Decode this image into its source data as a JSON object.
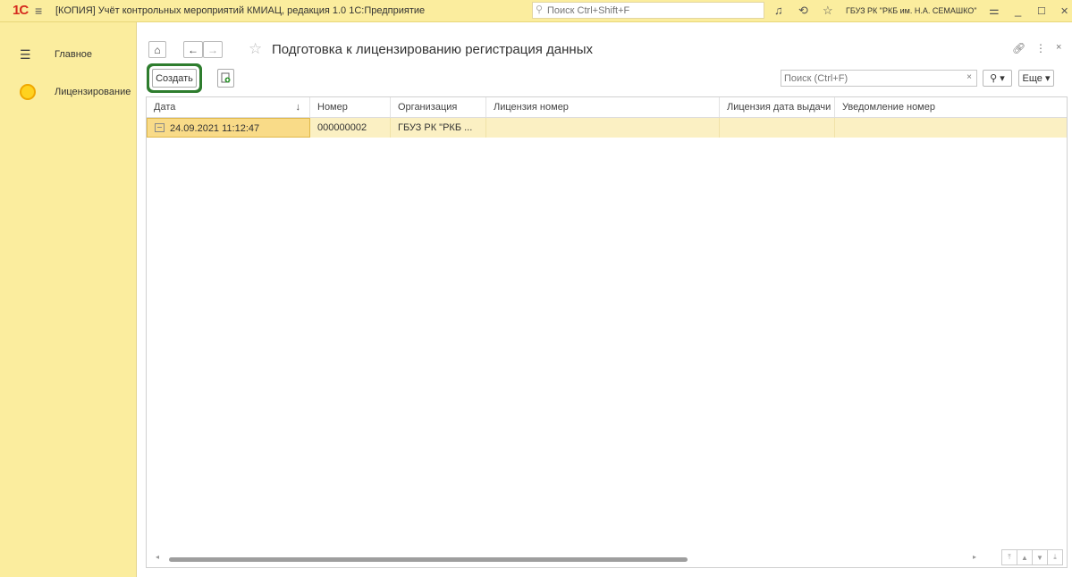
{
  "titlebar": {
    "logo": "1C",
    "title": "[КОПИЯ] Учёт контрольных мероприятий КМИАЦ, редакция 1.0 1С:Предприятие",
    "search_placeholder": "Поиск Ctrl+Shift+F",
    "user": "ГБУЗ РК \"РКБ им. Н.А. СЕМАШКО\""
  },
  "sidebar": {
    "items": [
      {
        "label": "Главное",
        "icon": "hamburger-icon"
      },
      {
        "label": "Лицензирование",
        "icon": "sun-icon"
      }
    ]
  },
  "page": {
    "title": "Подготовка к лицензированию регистрация данных"
  },
  "toolbar": {
    "create_label": "Создать",
    "search_placeholder": "Поиск (Ctrl+F)",
    "more_label": "Еще ▾"
  },
  "table": {
    "columns": [
      "Дата",
      "Номер",
      "Организация",
      "Лицензия номер",
      "Лицензия дата выдачи",
      "Уведомление номер"
    ],
    "sort_indicator": "↓",
    "rows": [
      {
        "date": "24.09.2021 11:12:47",
        "number": "000000002",
        "org": "ГБУЗ РК \"РКБ ...",
        "license_no": "",
        "license_date": "",
        "notice_no": ""
      }
    ]
  },
  "colors": {
    "accent_yellow": "#fbed9e",
    "selection": "#f9db88",
    "highlight_green": "#2e7d2e"
  }
}
